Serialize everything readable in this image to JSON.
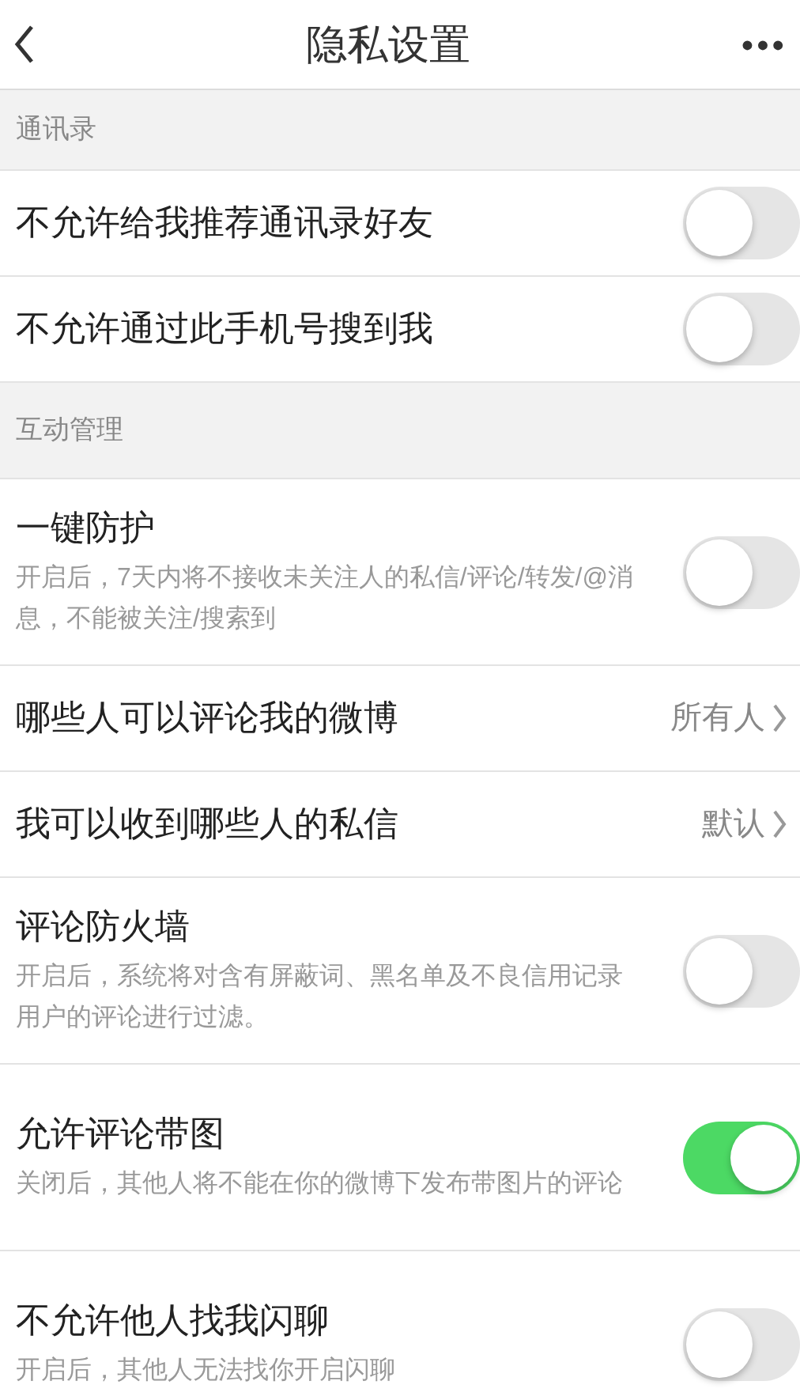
{
  "header": {
    "title": "隐私设置",
    "more": "•••"
  },
  "sections": [
    {
      "title": "通讯录",
      "items": [
        {
          "kind": "toggle",
          "label": "不允许给我推荐通讯录好友",
          "on": false
        },
        {
          "kind": "toggle",
          "label": "不允许通过此手机号搜到我",
          "on": false
        }
      ]
    },
    {
      "title": "互动管理",
      "items": [
        {
          "kind": "toggle",
          "label": "一键防护",
          "description": "开启后，7天内将不接收未关注人的私信/评论/转发/@消息，不能被关注/搜索到",
          "on": false
        },
        {
          "kind": "link",
          "label": "哪些人可以评论我的微博",
          "value": "所有人"
        },
        {
          "kind": "link",
          "label": "我可以收到哪些人的私信",
          "value": "默认"
        },
        {
          "kind": "toggle",
          "label": "评论防火墙",
          "description": "开启后，系统将对含有屏蔽词、黑名单及不良信用记录用户的评论进行过滤。",
          "on": false
        },
        {
          "kind": "toggle",
          "label": "允许评论带图",
          "description": "关闭后，其他人将不能在你的微博下发布带图片的评论",
          "on": true
        },
        {
          "kind": "toggle",
          "label": "不允许他人找我闪聊",
          "description": "开启后，其他人无法找你开启闪聊",
          "on": false
        }
      ]
    }
  ]
}
